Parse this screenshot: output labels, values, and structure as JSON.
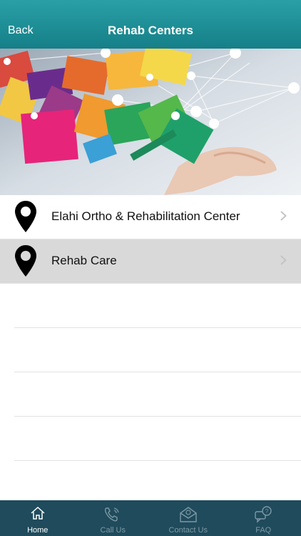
{
  "navbar": {
    "back_label": "Back",
    "title": "Rehab Centers"
  },
  "list": {
    "items": [
      {
        "label": "Elahi Ortho & Rehabilitation Center",
        "selected": false
      },
      {
        "label": "Rehab Care",
        "selected": true
      }
    ]
  },
  "tabbar": {
    "tabs": [
      {
        "label": "Home",
        "icon": "home-icon",
        "active": true
      },
      {
        "label": "Call Us",
        "icon": "phone-icon",
        "active": false
      },
      {
        "label": "Contact Us",
        "icon": "mail-icon",
        "active": false
      },
      {
        "label": "FAQ",
        "icon": "faq-chat-icon",
        "active": false
      }
    ]
  },
  "colors": {
    "navbar_top": "#2aa0a6",
    "navbar_bottom": "#157f88",
    "tabbar": "#1f4b5c",
    "selected_row": "#d9d9d9"
  }
}
